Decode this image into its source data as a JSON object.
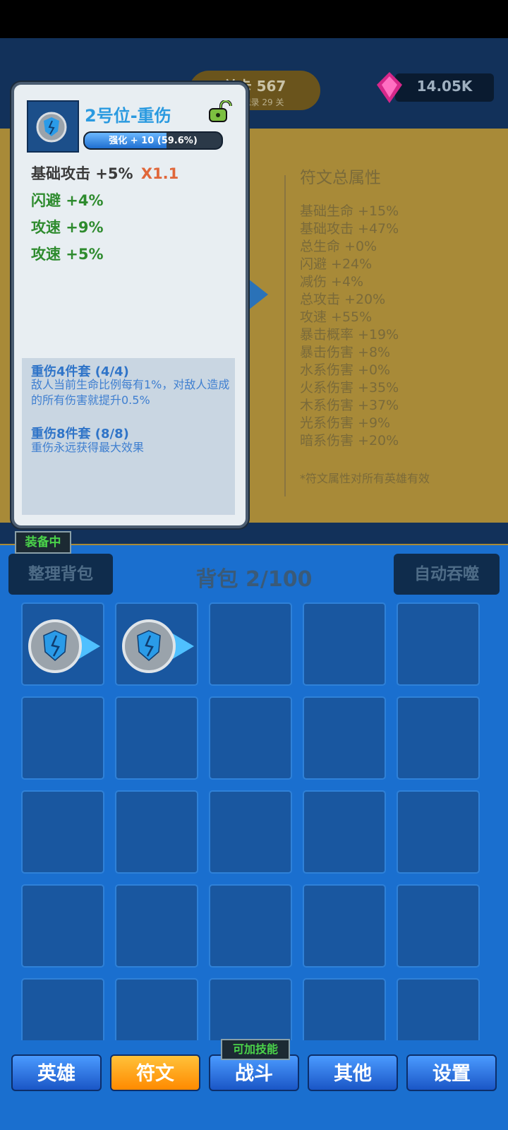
{
  "top": {
    "stage_label": "关卡 567",
    "stage_sub": "最高纪录 29 关",
    "gems": "14.05K",
    "accent": "#ff3fa0"
  },
  "detail": {
    "title": "2号位-重伤",
    "enhance": "强化 + 10  (59.6%)",
    "enhance_fraction": 0.596,
    "stats": [
      {
        "text": "基础攻击 +5%",
        "mult": "X1.1",
        "color": "#3a3a3a"
      },
      {
        "text": "闪避 +4%",
        "mult": "",
        "color": "#2e8b2e"
      },
      {
        "text": "攻速 +9%",
        "mult": "",
        "color": "#2e8b2e"
      },
      {
        "text": "攻速 +5%",
        "mult": "",
        "color": "#2e8b2e"
      }
    ],
    "sets": [
      {
        "title": "重伤4件套  (4/4)",
        "desc": "敌人当前生命比例每有1%，对敌人造成的所有伤害就提升0.5%"
      },
      {
        "title": "重伤8件套  (8/8)",
        "desc": "重伤永远获得最大效果"
      }
    ]
  },
  "runes_panel": {
    "title": "符文总属性",
    "lines": [
      "基础生命 +15%",
      "基础攻击 +47%",
      "总生命 +0%",
      "闪避 +24%",
      "减伤 +4%",
      "总攻击 +20%",
      "攻速 +55%",
      "暴击概率 +19%",
      "暴击伤害 +8%",
      "水系伤害 +0%",
      "火系伤害 +35%",
      "木系伤害 +37%",
      "光系伤害 +9%",
      "暗系伤害 +20%"
    ],
    "note": "*符文属性对所有英雄有效"
  },
  "equipped_tag": "装备中",
  "bag": {
    "sort_button": "整理背包",
    "title": "背包 2/100",
    "auto_button": "自动吞噬",
    "filled_slots": 2
  },
  "nav": {
    "badge": "可加技能",
    "items": [
      "英雄",
      "符文",
      "战斗",
      "其他",
      "设置"
    ],
    "active_index": 1
  }
}
